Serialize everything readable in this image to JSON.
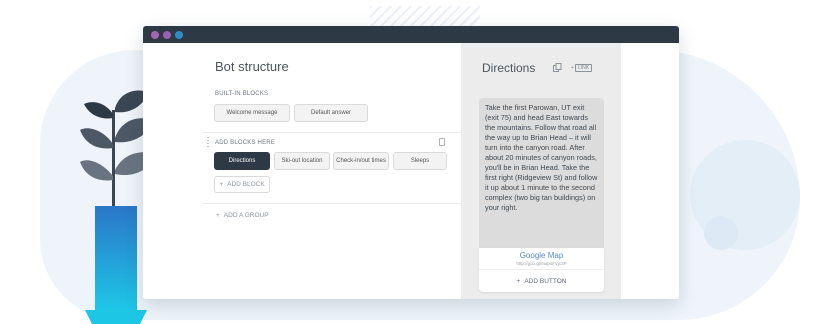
{
  "window": {
    "dots": [
      {
        "name": "close",
        "color": "#a566ad"
      },
      {
        "name": "minimize",
        "color": "#9b5fb3"
      },
      {
        "name": "maximize",
        "color": "#2f8cc0"
      }
    ]
  },
  "left": {
    "title": "Bot structure",
    "builtin_label": "BUILT-IN BLOCKS",
    "builtin": [
      "Welcome message",
      "Default answer"
    ],
    "add_blocks_label": "ADD BLOCKS HERE",
    "blocks": [
      "Directions",
      "Ski-out location",
      "Check-in/out times",
      "Sleeps"
    ],
    "add_block": "ADD BLOCK",
    "add_group": "ADD A GROUP"
  },
  "right": {
    "title": "Directions",
    "link_badge": "LINK",
    "message": "Take the first Parowan, UT exit (exit 75) and head East towards the mountains. Follow that road all the way up to Brian Head – it will turn into the canyon road. After about 20 minutes of canyon roads, you'll be in Brian Head. Take the first right (Ridgeview St) and follow it up about 1 minute to the second complex (two big tan buildings) on your right.",
    "button_title": "Google Map",
    "button_url": "http://goo.gl/maps/rVjc3P",
    "add_button": "ADD BUTTON"
  },
  "colors": {
    "accent": "#2d3945",
    "link": "#5b8bc7"
  }
}
